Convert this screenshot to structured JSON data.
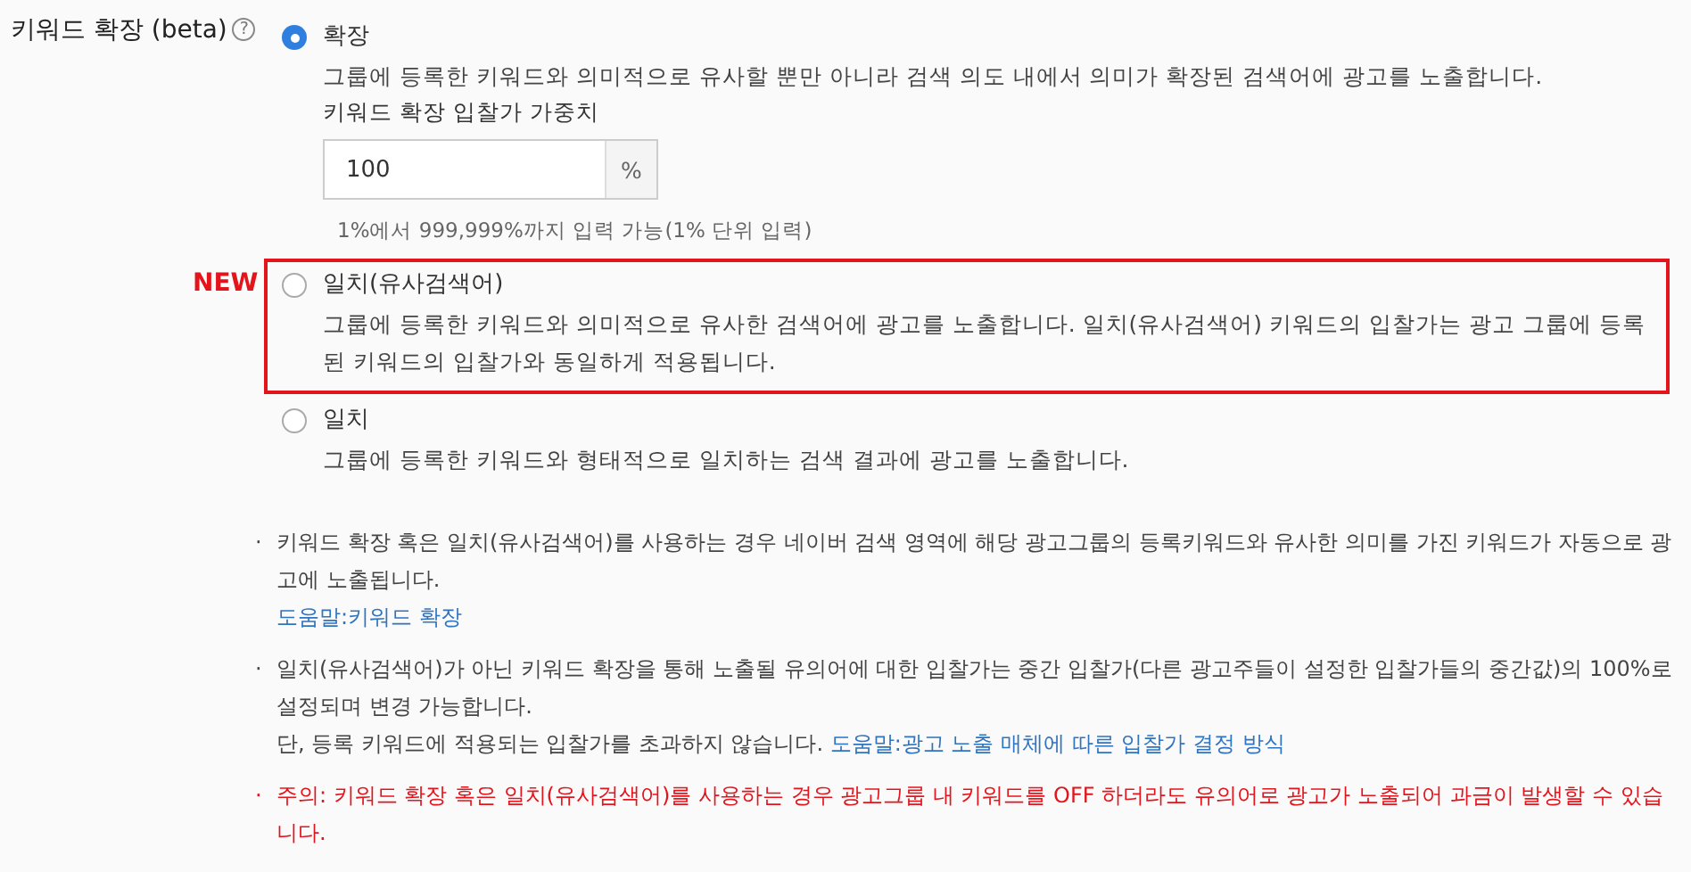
{
  "setting": {
    "label": "키워드 확장 (beta)",
    "help_icon": "?"
  },
  "options": [
    {
      "label": "확장",
      "selected": true,
      "is_new": false,
      "description": "그룹에 등록한 키워드와 의미적으로 유사할 뿐만 아니라 검색 의도 내에서 의미가 확장된 검색어에 광고를 노출합니다.",
      "bid_weight": {
        "label": "키워드 확장 입찰가 가중치",
        "value": "100",
        "unit": "%",
        "hint": "1%에서 999,999%까지 입력 가능(1% 단위 입력)"
      }
    },
    {
      "label": "일치(유사검색어)",
      "selected": false,
      "is_new": true,
      "badge": "NEW",
      "description": "그룹에 등록한 키워드와 의미적으로 유사한 검색어에 광고를 노출합니다. 일치(유사검색어) 키워드의 입찰가는 광고 그룹에 등록된 키워드의 입찰가와 동일하게 적용됩니다."
    },
    {
      "label": "일치",
      "selected": false,
      "is_new": false,
      "description": "그룹에 등록한 키워드와 형태적으로 일치하는 검색 결과에 광고를 노출합니다."
    }
  ],
  "notes": [
    {
      "kind": "info",
      "bullet": "·",
      "text": "키워드 확장 혹은 일치(유사검색어)를 사용하는 경우 네이버 검색 영역에 해당 광고그룹의 등록키워드와 유사한 의미를 가진 키워드가 자동으로 광고에 노출됩니다.",
      "link": "도움말:키워드 확장"
    },
    {
      "kind": "info",
      "bullet": "·",
      "text": "일치(유사검색어)가 아닌 키워드 확장을 통해 노출될 유의어에 대한 입찰가는 중간 입찰가(다른 광고주들이 설정한 입찰가들의 중간값)의 100%로 설정되며 변경 가능합니다.",
      "sub_text": "단, 등록 키워드에 적용되는 입찰가를 초과하지 않습니다.",
      "link": "도움말:광고 노출 매체에 따른 입찰가 결정 방식"
    },
    {
      "kind": "warning",
      "bullet": "·",
      "text": "주의: 키워드 확장 혹은 일치(유사검색어)를 사용하는 경우 광고그룹 내 키워드를 OFF 하더라도 유의어로 광고가 노출되어 과금이 발생할 수 있습니다."
    }
  ]
}
